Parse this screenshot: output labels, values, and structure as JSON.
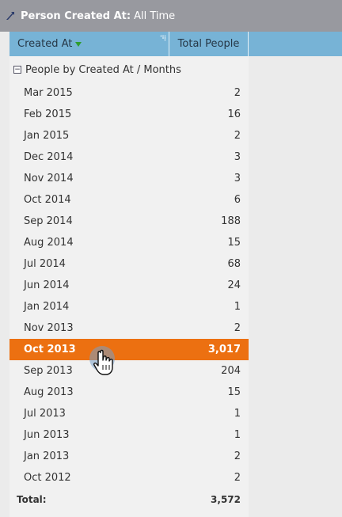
{
  "header": {
    "title_label": "Person Created At:",
    "title_value": "All Time"
  },
  "columns": {
    "created_at": "Created At",
    "total_people": "Total People"
  },
  "group": {
    "label": "People by Created At / Months"
  },
  "rows": [
    {
      "month": "Mar 2015",
      "total": "2"
    },
    {
      "month": "Feb 2015",
      "total": "16"
    },
    {
      "month": "Jan 2015",
      "total": "2"
    },
    {
      "month": "Dec 2014",
      "total": "3"
    },
    {
      "month": "Nov 2014",
      "total": "3"
    },
    {
      "month": "Oct 2014",
      "total": "6"
    },
    {
      "month": "Sep 2014",
      "total": "188"
    },
    {
      "month": "Aug 2014",
      "total": "15"
    },
    {
      "month": "Jul 2014",
      "total": "68"
    },
    {
      "month": "Jun 2014",
      "total": "24"
    },
    {
      "month": "Jan 2014",
      "total": "1"
    },
    {
      "month": "Nov 2013",
      "total": "2"
    },
    {
      "month": "Oct 2013",
      "total": "3,017"
    },
    {
      "month": "Sep 2013",
      "total": "204"
    },
    {
      "month": "Aug 2013",
      "total": "15"
    },
    {
      "month": "Jul 2013",
      "total": "1"
    },
    {
      "month": "Jun 2013",
      "total": "1"
    },
    {
      "month": "Jan 2013",
      "total": "2"
    },
    {
      "month": "Oct 2012",
      "total": "2"
    }
  ],
  "total": {
    "label": "Total:",
    "value": "3,572"
  },
  "colors": {
    "selected_row": "#ec7011",
    "header_bar": "#77b3d6",
    "title_bar": "#98999f"
  },
  "icons": {
    "title": "arrow-pointer-icon",
    "sort": "sort-descending-icon",
    "collapse": "collapse-minus-icon",
    "cursor": "hand-pointer-icon"
  }
}
